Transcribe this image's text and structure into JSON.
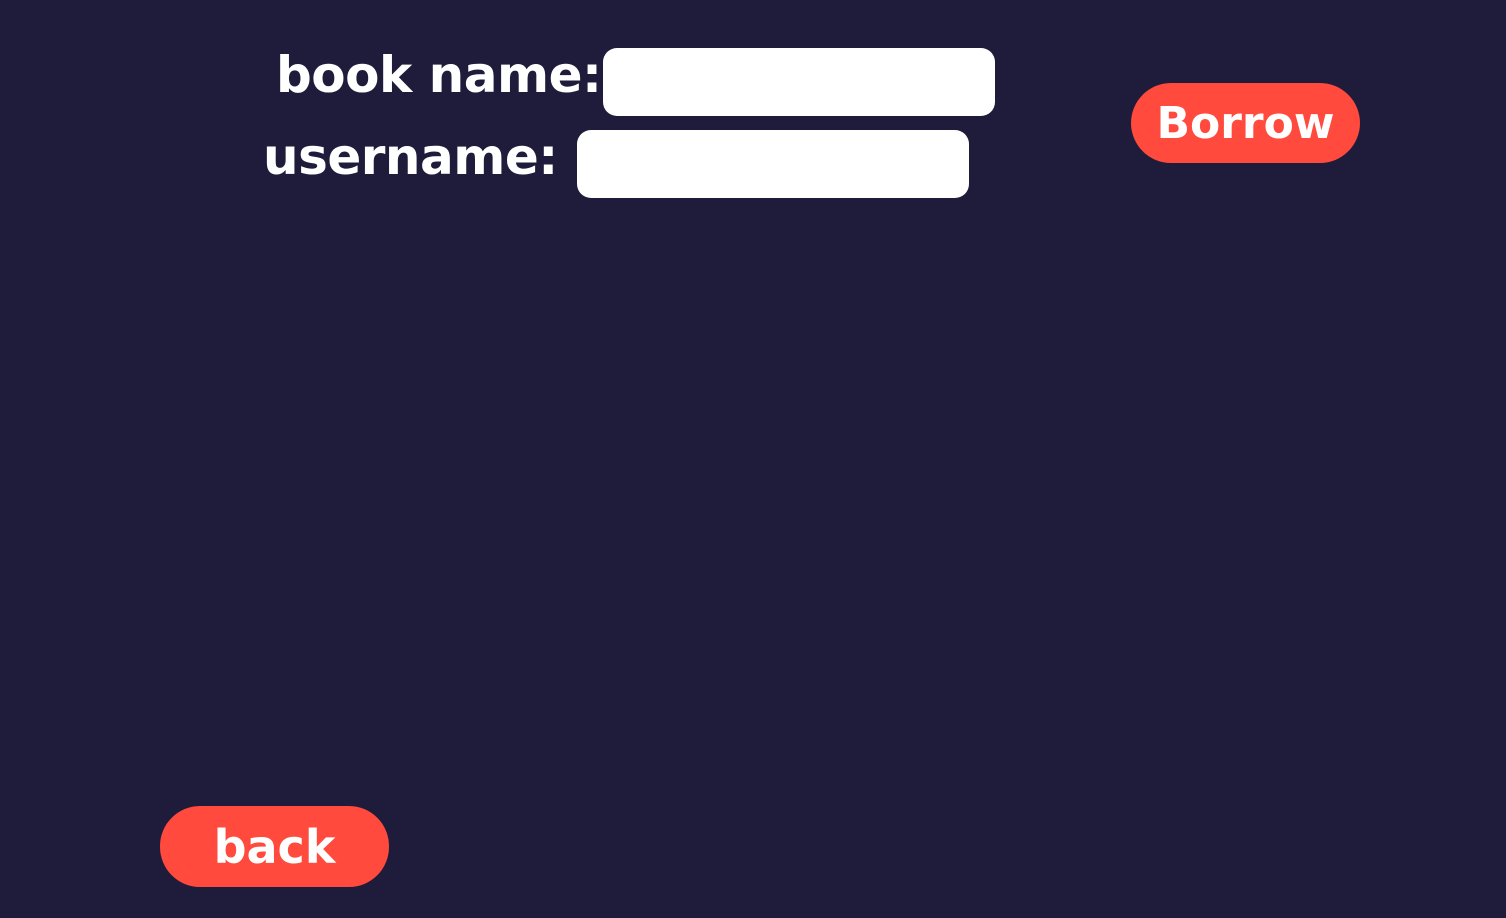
{
  "form": {
    "book_name_label": "book name:",
    "book_name_value": "",
    "username_label": "username:",
    "username_value": ""
  },
  "actions": {
    "borrow_label": "Borrow",
    "back_label": "back"
  },
  "colors": {
    "background": "#1e1c3a",
    "accent": "#ff4a3d",
    "text": "#ffffff",
    "field": "#ffffff"
  }
}
